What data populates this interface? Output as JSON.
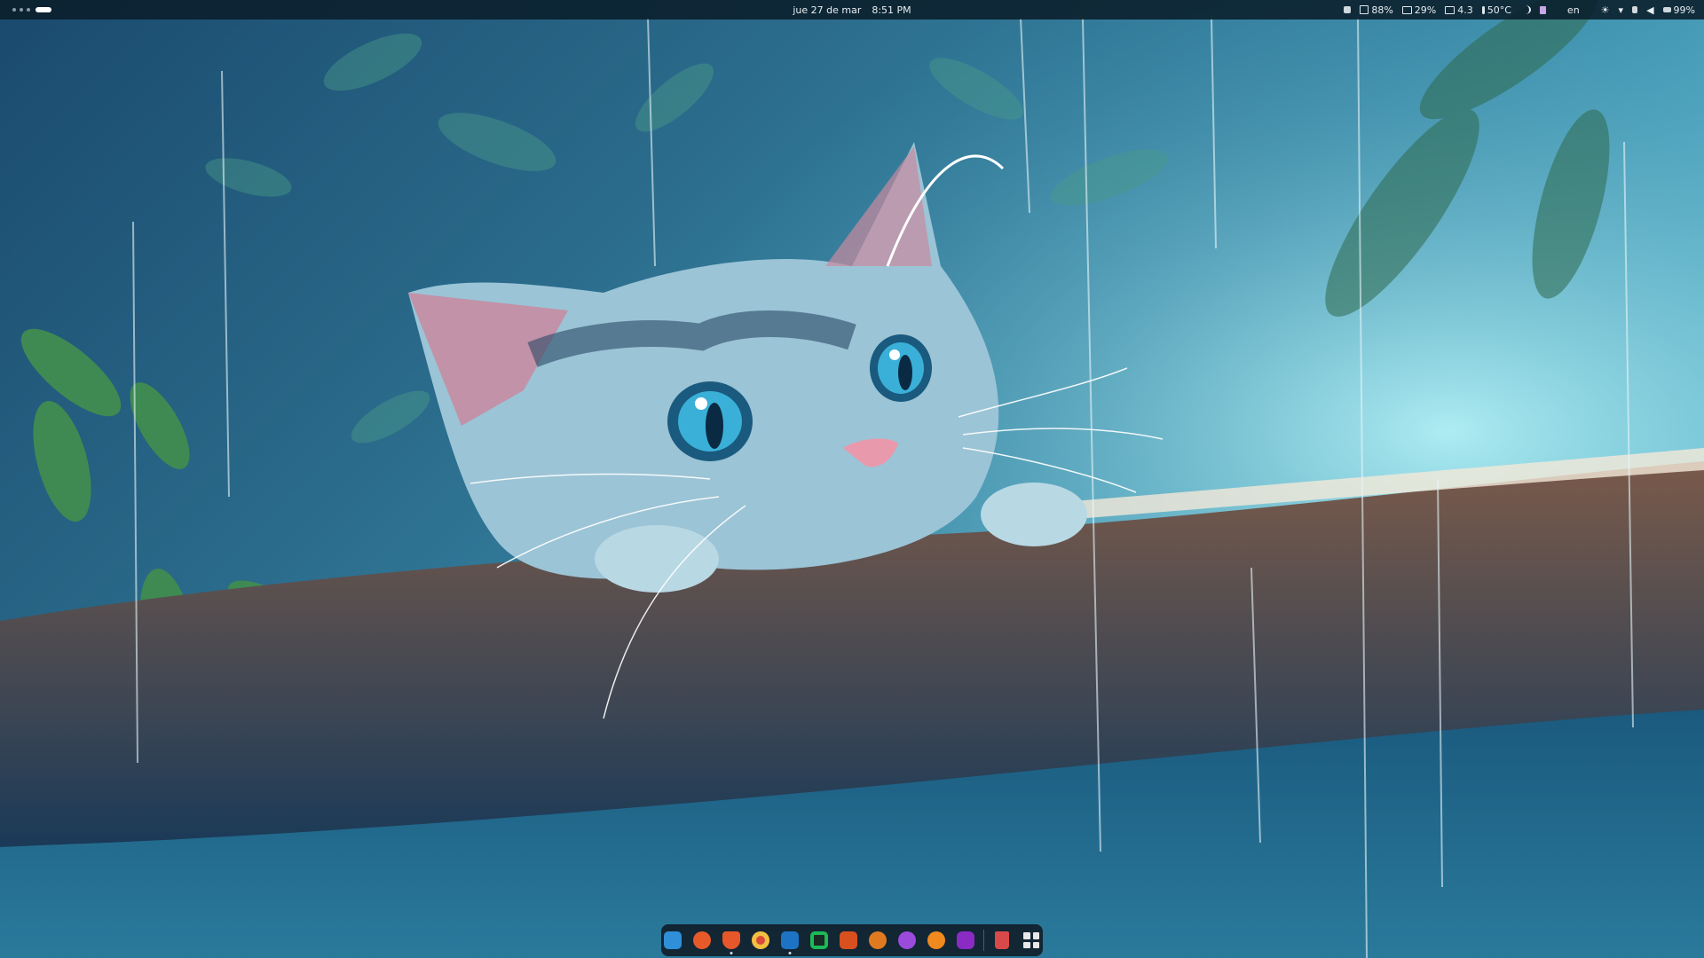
{
  "topbar": {
    "date": "jue 27 de mar",
    "time": "8:51 PM",
    "stats": {
      "cpu": "88%",
      "memory": "29%",
      "load": "4.3",
      "temperature": "50°C"
    },
    "language": "en",
    "battery": "99%"
  },
  "dock": {
    "apps": [
      {
        "name": "files",
        "color": "#2f8fd8"
      },
      {
        "name": "firefox",
        "color": "#e65a2a"
      },
      {
        "name": "brave",
        "color": "#e8572a"
      },
      {
        "name": "chrome",
        "color": "#d84a3a"
      },
      {
        "name": "vscode",
        "color": "#1d73c4"
      },
      {
        "name": "spotify",
        "color": "#1cb954"
      },
      {
        "name": "terminal",
        "color": "#d8501e"
      },
      {
        "name": "settings",
        "color": "#e07a20"
      },
      {
        "name": "obs",
        "color": "#9b4bdc"
      },
      {
        "name": "blender",
        "color": "#f08a1e"
      },
      {
        "name": "krita",
        "color": "#8a2bc4"
      },
      {
        "name": "trash",
        "color": "#d84a4a"
      }
    ]
  },
  "colors": {
    "topbar_bg": "#0a1e2a",
    "dock_bg": "#0e1822"
  }
}
